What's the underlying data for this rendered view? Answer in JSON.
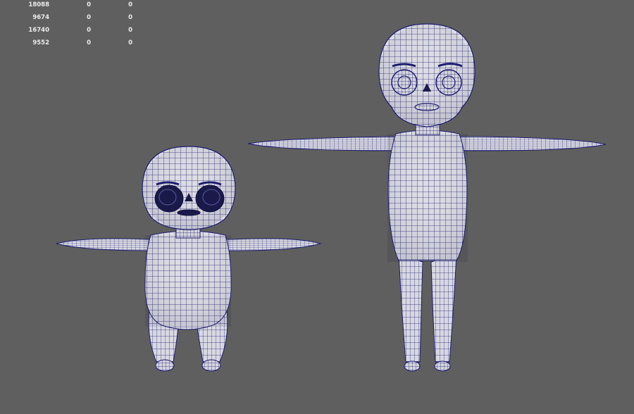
{
  "hud": {
    "rows": [
      {
        "a": "18088",
        "b": "0",
        "c": "0"
      },
      {
        "a": "9674",
        "b": "0",
        "c": "0"
      },
      {
        "a": "16740",
        "b": "0",
        "c": "0"
      },
      {
        "a": "9552",
        "b": "0",
        "c": "0"
      }
    ]
  },
  "scene": {
    "background_color": "#5f5f5f",
    "mesh_fill": "#dcdce4",
    "wire_color": "#1c1c6e",
    "models": [
      "child-skeleton-mesh",
      "adult-skeleton-mesh"
    ]
  }
}
